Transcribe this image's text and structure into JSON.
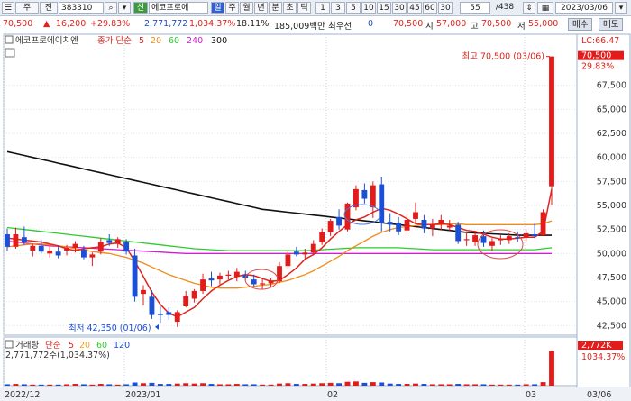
{
  "toolbar": {
    "menu_label": "주",
    "type_label": "전",
    "code": "383310",
    "search_icon": "search-icon",
    "stock_badge": "신",
    "stock_name": "에코프로에",
    "period_tabs": [
      "일",
      "주",
      "월",
      "년",
      "분",
      "초",
      "틱"
    ],
    "interval_buttons": [
      "1",
      "3",
      "5",
      "10",
      "15",
      "30",
      "45",
      "60",
      "30"
    ],
    "page_count": "55",
    "page_total": "/438",
    "date": "2023/03/06"
  },
  "quote": {
    "price": "70,500",
    "change": "16,200",
    "change_pct": "+29.83%",
    "volume": "2,771,772",
    "volume_pct": "1,034.37%",
    "turnover": "18.11%",
    "amount": "185,009백만",
    "best_label": "최우선",
    "best_ask": "0",
    "best_bid": "70,500",
    "open_label": "시",
    "open": "57,000",
    "high_label": "고",
    "high": "70,500",
    "low_label": "저",
    "low": "55,000",
    "buy_button": "매수",
    "sell_button": "매도"
  },
  "legend": {
    "title": "에코프로에이치엔",
    "ma_label": "종가 단순",
    "periods": [
      "5",
      "20",
      "60",
      "240",
      "300"
    ],
    "period_colors": [
      "#e0241b",
      "#f08c1a",
      "#2ccc2c",
      "#d11ed1",
      "#111111"
    ]
  },
  "volume_legend": {
    "title": "거래량",
    "ma_label": "단순",
    "periods": [
      "5",
      "20",
      "60",
      "120"
    ],
    "period_colors": [
      "#e0241b",
      "#f0a020",
      "#2ccc2c",
      "#1f4fc4"
    ],
    "summary": "2,771,772주(1,034.37%)"
  },
  "annotations": {
    "high": "최고 70,500 (03/06)",
    "low": "최저 42,350 (01/06)"
  },
  "right_labels": {
    "lc": "LC:66.47",
    "price": "70,500",
    "pct": "29.83%",
    "volume": "2,772K",
    "volume_pct": "1034.37%"
  },
  "chart_data": {
    "type": "candlestick",
    "y_ticks": [
      "67,500",
      "65,000",
      "62,500",
      "60,000",
      "57,500",
      "55,000",
      "52,500",
      "50,000",
      "47,500",
      "45,000",
      "42,500"
    ],
    "ylim": [
      41500,
      71500
    ],
    "x_labels": [
      "2022/12",
      "2023/01",
      "02",
      "03",
      "03/06"
    ],
    "candles": [
      {
        "o": 52000,
        "h": 52600,
        "l": 50300,
        "c": 50700
      },
      {
        "o": 50700,
        "h": 52700,
        "l": 50500,
        "c": 52000
      },
      {
        "o": 51700,
        "h": 52800,
        "l": 50900,
        "c": 51200
      },
      {
        "o": 50300,
        "h": 51000,
        "l": 49700,
        "c": 50800
      },
      {
        "o": 50800,
        "h": 51400,
        "l": 50000,
        "c": 50200
      },
      {
        "o": 50000,
        "h": 50800,
        "l": 49600,
        "c": 50300
      },
      {
        "o": 50200,
        "h": 50800,
        "l": 49500,
        "c": 49800
      },
      {
        "o": 50300,
        "h": 50900,
        "l": 49800,
        "c": 50600
      },
      {
        "o": 50600,
        "h": 51300,
        "l": 50100,
        "c": 51000
      },
      {
        "o": 50400,
        "h": 50800,
        "l": 49400,
        "c": 49600
      },
      {
        "o": 49600,
        "h": 50100,
        "l": 48700,
        "c": 49900
      },
      {
        "o": 50200,
        "h": 51600,
        "l": 49900,
        "c": 51200
      },
      {
        "o": 51400,
        "h": 52000,
        "l": 50800,
        "c": 51100
      },
      {
        "o": 51000,
        "h": 51700,
        "l": 50600,
        "c": 51500
      },
      {
        "o": 51200,
        "h": 51500,
        "l": 49900,
        "c": 50200
      },
      {
        "o": 49800,
        "h": 50500,
        "l": 45000,
        "c": 45500
      },
      {
        "o": 45800,
        "h": 46700,
        "l": 44600,
        "c": 46200
      },
      {
        "o": 45500,
        "h": 46200,
        "l": 43200,
        "c": 43600
      },
      {
        "o": 43700,
        "h": 44500,
        "l": 42800,
        "c": 43600
      },
      {
        "o": 43900,
        "h": 44400,
        "l": 43100,
        "c": 43600
      },
      {
        "o": 42900,
        "h": 44100,
        "l": 42350,
        "c": 43900
      },
      {
        "o": 44500,
        "h": 46100,
        "l": 44400,
        "c": 45600
      },
      {
        "o": 45300,
        "h": 46300,
        "l": 44900,
        "c": 46100
      },
      {
        "o": 46100,
        "h": 47900,
        "l": 45800,
        "c": 47300
      },
      {
        "o": 47400,
        "h": 48100,
        "l": 46600,
        "c": 47200
      },
      {
        "o": 47300,
        "h": 48000,
        "l": 46800,
        "c": 47700
      },
      {
        "o": 47700,
        "h": 48200,
        "l": 47300,
        "c": 47800
      },
      {
        "o": 47600,
        "h": 48500,
        "l": 47100,
        "c": 48100
      },
      {
        "o": 47800,
        "h": 48200,
        "l": 47200,
        "c": 47500
      },
      {
        "o": 47300,
        "h": 47800,
        "l": 46600,
        "c": 46800
      },
      {
        "o": 46800,
        "h": 47500,
        "l": 46300,
        "c": 46900
      },
      {
        "o": 46900,
        "h": 47500,
        "l": 46500,
        "c": 47200
      },
      {
        "o": 47100,
        "h": 49100,
        "l": 46900,
        "c": 48700
      },
      {
        "o": 48700,
        "h": 50200,
        "l": 48400,
        "c": 49900
      },
      {
        "o": 50200,
        "h": 50700,
        "l": 49700,
        "c": 49900
      },
      {
        "o": 49900,
        "h": 50500,
        "l": 49300,
        "c": 50100
      },
      {
        "o": 50100,
        "h": 51400,
        "l": 49800,
        "c": 51000
      },
      {
        "o": 51200,
        "h": 52600,
        "l": 50900,
        "c": 52200
      },
      {
        "o": 52200,
        "h": 53600,
        "l": 51800,
        "c": 53400
      },
      {
        "o": 53800,
        "h": 54600,
        "l": 52500,
        "c": 52900
      },
      {
        "o": 52500,
        "h": 55300,
        "l": 52300,
        "c": 55200
      },
      {
        "o": 54800,
        "h": 57100,
        "l": 54500,
        "c": 56700
      },
      {
        "o": 56600,
        "h": 57300,
        "l": 55200,
        "c": 55700
      },
      {
        "o": 54800,
        "h": 57500,
        "l": 53700,
        "c": 57100
      },
      {
        "o": 57200,
        "h": 58000,
        "l": 52300,
        "c": 53200
      },
      {
        "o": 53300,
        "h": 54200,
        "l": 52300,
        "c": 53000
      },
      {
        "o": 53200,
        "h": 53800,
        "l": 51900,
        "c": 52300
      },
      {
        "o": 52400,
        "h": 54100,
        "l": 52000,
        "c": 53500
      },
      {
        "o": 53600,
        "h": 55300,
        "l": 53100,
        "c": 54300
      },
      {
        "o": 53500,
        "h": 54000,
        "l": 52100,
        "c": 52600
      },
      {
        "o": 52600,
        "h": 53600,
        "l": 51800,
        "c": 53000
      },
      {
        "o": 53100,
        "h": 54000,
        "l": 52400,
        "c": 53500
      },
      {
        "o": 52700,
        "h": 53500,
        "l": 52400,
        "c": 52900
      },
      {
        "o": 53000,
        "h": 53300,
        "l": 51000,
        "c": 51300
      },
      {
        "o": 51400,
        "h": 52200,
        "l": 50800,
        "c": 51500
      },
      {
        "o": 51200,
        "h": 52300,
        "l": 50800,
        "c": 51900
      },
      {
        "o": 51800,
        "h": 52400,
        "l": 50700,
        "c": 51100
      },
      {
        "o": 50800,
        "h": 51600,
        "l": 50300,
        "c": 51300
      },
      {
        "o": 51400,
        "h": 51900,
        "l": 50900,
        "c": 51500
      },
      {
        "o": 51400,
        "h": 52100,
        "l": 51000,
        "c": 51800
      },
      {
        "o": 51700,
        "h": 52300,
        "l": 51200,
        "c": 51600
      },
      {
        "o": 51700,
        "h": 52500,
        "l": 51300,
        "c": 52100
      },
      {
        "o": 52000,
        "h": 53100,
        "l": 51600,
        "c": 51800
      },
      {
        "o": 51900,
        "h": 54600,
        "l": 51800,
        "c": 54300
      },
      {
        "o": 57000,
        "h": 70500,
        "l": 55000,
        "c": 70500
      }
    ],
    "ma5": [
      51600,
      51500,
      51400,
      51300,
      51200,
      51000,
      50800,
      50500,
      50300,
      50500,
      50600,
      50700,
      51000,
      51100,
      50600,
      49200,
      47600,
      46000,
      44700,
      43800,
      43400,
      43900,
      44400,
      45300,
      46100,
      46700,
      47200,
      47600,
      47800,
      47700,
      47400,
      47100,
      47200,
      47800,
      48500,
      49400,
      49900,
      50600,
      51500,
      52300,
      53000,
      53500,
      53800,
      54300,
      54700,
      54500,
      54100,
      53600,
      53100,
      53000,
      53000,
      53100,
      53000,
      52700,
      52400,
      52300,
      52000,
      51700,
      51500,
      51500,
      51600,
      51700,
      51700,
      52300,
      56700
    ],
    "ma20": [
      50700,
      50800,
      50900,
      51000,
      51000,
      50900,
      50800,
      50700,
      50500,
      50400,
      50200,
      50100,
      50000,
      49800,
      49600,
      49300,
      49000,
      48600,
      48200,
      47800,
      47500,
      47200,
      46900,
      46700,
      46500,
      46400,
      46400,
      46400,
      46500,
      46600,
      46700,
      46800,
      47000,
      47200,
      47500,
      47800,
      48200,
      48700,
      49200,
      49700,
      50300,
      50800,
      51300,
      51800,
      52200,
      52500,
      52700,
      52800,
      52900,
      53000,
      53000,
      53000,
      53100,
      53100,
      53000,
      53000,
      53000,
      53000,
      53000,
      53000,
      53000,
      53000,
      53000,
      53100,
      53400
    ],
    "ma60": [
      52700,
      52600,
      52500,
      52400,
      52300,
      52200,
      52100,
      52000,
      51900,
      51800,
      51700,
      51600,
      51500,
      51400,
      51300,
      51200,
      51100,
      51000,
      50900,
      50800,
      50700,
      50600,
      50500,
      50450,
      50400,
      50350,
      50300,
      50300,
      50300,
      50300,
      50300,
      50300,
      50300,
      50300,
      50300,
      50300,
      50350,
      50400,
      50450,
      50500,
      50550,
      50600,
      50600,
      50600,
      50600,
      50600,
      50600,
      50550,
      50500,
      50450,
      50400,
      50400,
      50400,
      50400,
      50400,
      50400,
      50400,
      50400,
      50400,
      50400,
      50400,
      50400,
      50400,
      50500,
      50600
    ],
    "ma240": [
      51300,
      51200,
      51100,
      51000,
      50900,
      50800,
      50750,
      50700,
      50650,
      50600,
      50550,
      50500,
      50450,
      50400,
      50350,
      50300,
      50250,
      50200,
      50150,
      50100,
      50050,
      50000,
      50000,
      50000,
      50000,
      50000,
      50000,
      50000,
      50000,
      50000,
      50000,
      50000,
      50000,
      50000,
      50000,
      50000,
      50000,
      50000,
      50000,
      50000,
      50000,
      50000,
      50000,
      50000,
      50000,
      50000,
      50000,
      50000,
      50000,
      50000,
      50000,
      50000,
      50000,
      50000,
      50000,
      50000,
      50000,
      50000,
      50000,
      50000,
      50000,
      50000,
      50000,
      50000,
      50000
    ],
    "ma300": [
      60600,
      60400,
      60200,
      60000,
      59800,
      59600,
      59400,
      59200,
      59000,
      58800,
      58600,
      58400,
      58200,
      58000,
      57800,
      57600,
      57400,
      57200,
      57000,
      56800,
      56600,
      56400,
      56200,
      56000,
      55800,
      55600,
      55400,
      55200,
      55000,
      54800,
      54600,
      54500,
      54400,
      54300,
      54200,
      54100,
      54000,
      53900,
      53800,
      53700,
      53600,
      53500,
      53400,
      53300,
      53200,
      53100,
      53000,
      52900,
      52800,
      52700,
      52600,
      52500,
      52400,
      52300,
      52200,
      52150,
      52100,
      52050,
      52000,
      51950,
      51900,
      51900,
      51900,
      51900,
      51900
    ],
    "volume_relative": [
      0.04,
      0.05,
      0.04,
      0.03,
      0.03,
      0.03,
      0.03,
      0.04,
      0.05,
      0.04,
      0.03,
      0.05,
      0.04,
      0.03,
      0.04,
      0.09,
      0.07,
      0.08,
      0.05,
      0.05,
      0.06,
      0.07,
      0.06,
      0.07,
      0.05,
      0.04,
      0.04,
      0.05,
      0.04,
      0.04,
      0.03,
      0.03,
      0.06,
      0.07,
      0.05,
      0.05,
      0.06,
      0.07,
      0.08,
      0.07,
      0.11,
      0.12,
      0.08,
      0.1,
      0.09,
      0.06,
      0.05,
      0.05,
      0.06,
      0.05,
      0.04,
      0.04,
      0.04,
      0.05,
      0.04,
      0.04,
      0.04,
      0.03,
      0.03,
      0.03,
      0.03,
      0.04,
      0.04,
      0.1,
      1.0
    ]
  }
}
